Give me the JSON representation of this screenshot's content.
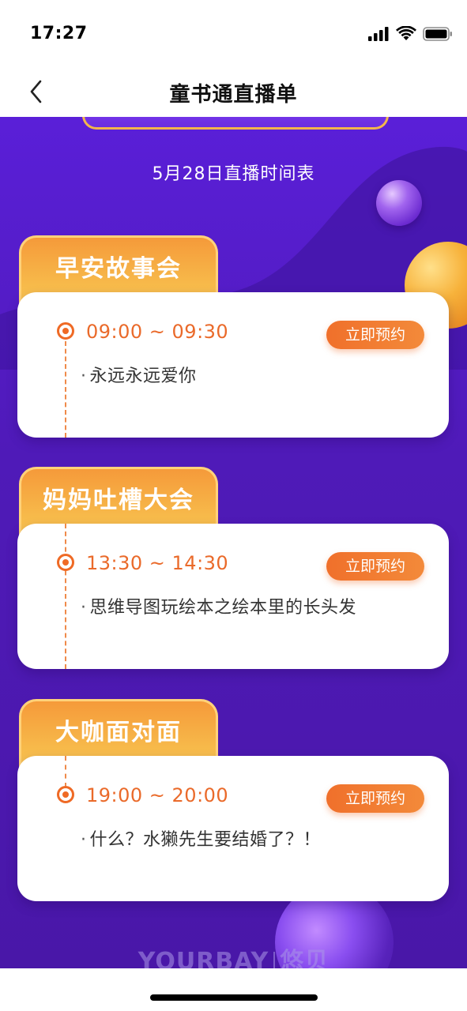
{
  "status_bar": {
    "time": "17:27",
    "icons": [
      "signal-icon",
      "wifi-icon",
      "battery-icon"
    ]
  },
  "nav": {
    "back_icon": "chevron-left-icon",
    "title": "童书通直播单"
  },
  "schedule": {
    "heading": "5月28日直播时间表",
    "book_label": "立即预约",
    "sessions": [
      {
        "tab": "早安故事会",
        "time": "09:00 ~ 09:30",
        "program": "永远永远爱你"
      },
      {
        "tab": "妈妈吐槽大会",
        "time": "13:30 ~ 14:30",
        "program": "思维导图玩绘本之绘本里的长头发"
      },
      {
        "tab": "大咖面对面",
        "time": "19:00 ~ 20:00",
        "program": "什么？水獭先生要结婚了？！"
      }
    ]
  },
  "brand": {
    "latin": "YOURBAY",
    "chinese": "悠贝"
  },
  "colors": {
    "background_purple": "#5a1fd8",
    "accent_orange": "#ef6a25",
    "tab_gold": "#f7b94a"
  }
}
